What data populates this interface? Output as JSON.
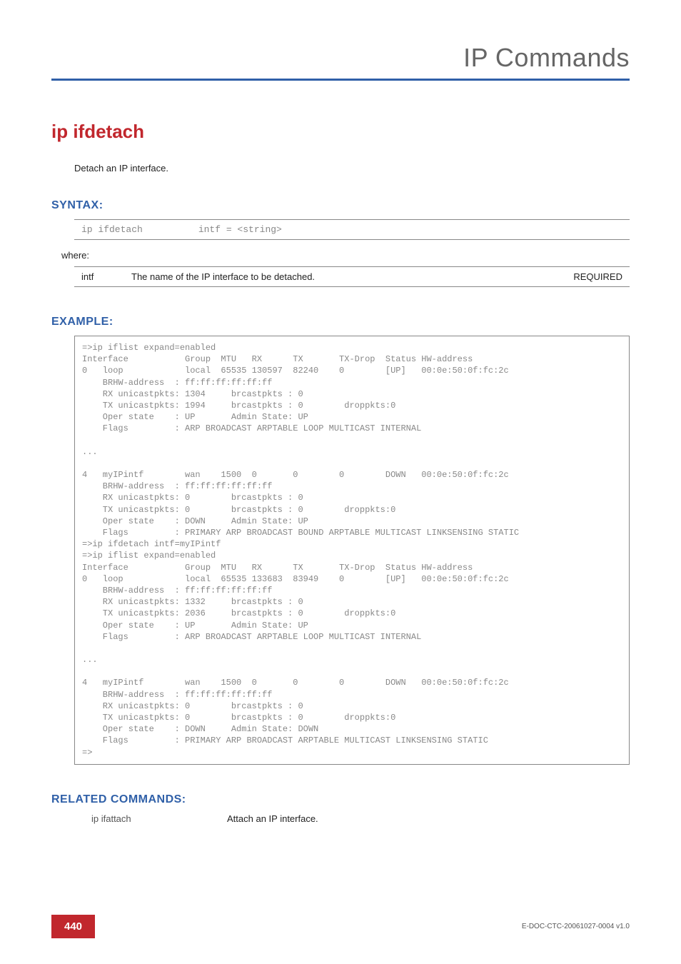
{
  "header": {
    "title": "IP Commands"
  },
  "command": {
    "name": "ip ifdetach",
    "description": "Detach an IP interface."
  },
  "syntax": {
    "heading": "SYNTAX:",
    "line": "ip ifdetach          intf = <string>",
    "where": "where:",
    "param": {
      "name": "intf",
      "desc": "The name of the IP interface to be detached.",
      "req": "REQUIRED"
    }
  },
  "example": {
    "heading": "EXAMPLE:",
    "text": "=>ip iflist expand=enabled\nInterface           Group  MTU   RX      TX       TX-Drop  Status HW-address\n0   loop            local  65535 130597  82240    0        [UP]   00:0e:50:0f:fc:2c\n    BRHW-address  : ff:ff:ff:ff:ff:ff\n    RX unicastpkts: 1304     brcastpkts : 0\n    TX unicastpkts: 1994     brcastpkts : 0        droppkts:0\n    Oper state    : UP       Admin State: UP\n    Flags         : ARP BROADCAST ARPTABLE LOOP MULTICAST INTERNAL\n\n...\n\n4   myIPintf        wan    1500  0       0        0        DOWN   00:0e:50:0f:fc:2c\n    BRHW-address  : ff:ff:ff:ff:ff:ff\n    RX unicastpkts: 0        brcastpkts : 0\n    TX unicastpkts: 0        brcastpkts : 0        droppkts:0\n    Oper state    : DOWN     Admin State: UP\n    Flags         : PRIMARY ARP BROADCAST BOUND ARPTABLE MULTICAST LINKSENSING STATIC\n=>ip ifdetach intf=myIPintf\n=>ip iflist expand=enabled\nInterface           Group  MTU   RX      TX       TX-Drop  Status HW-address\n0   loop            local  65535 133683  83949    0        [UP]   00:0e:50:0f:fc:2c\n    BRHW-address  : ff:ff:ff:ff:ff:ff\n    RX unicastpkts: 1332     brcastpkts : 0\n    TX unicastpkts: 2036     brcastpkts : 0        droppkts:0\n    Oper state    : UP       Admin State: UP\n    Flags         : ARP BROADCAST ARPTABLE LOOP MULTICAST INTERNAL\n\n...\n\n4   myIPintf        wan    1500  0       0        0        DOWN   00:0e:50:0f:fc:2c\n    BRHW-address  : ff:ff:ff:ff:ff:ff\n    RX unicastpkts: 0        brcastpkts : 0\n    TX unicastpkts: 0        brcastpkts : 0        droppkts:0\n    Oper state    : DOWN     Admin State: DOWN\n    Flags         : PRIMARY ARP BROADCAST ARPTABLE MULTICAST LINKSENSING STATIC\n=>"
  },
  "related": {
    "heading": "RELATED COMMANDS:",
    "cmd": "ip ifattach",
    "desc": "Attach an IP interface."
  },
  "footer": {
    "page": "440",
    "doc": "E-DOC-CTC-20061027-0004 v1.0"
  }
}
